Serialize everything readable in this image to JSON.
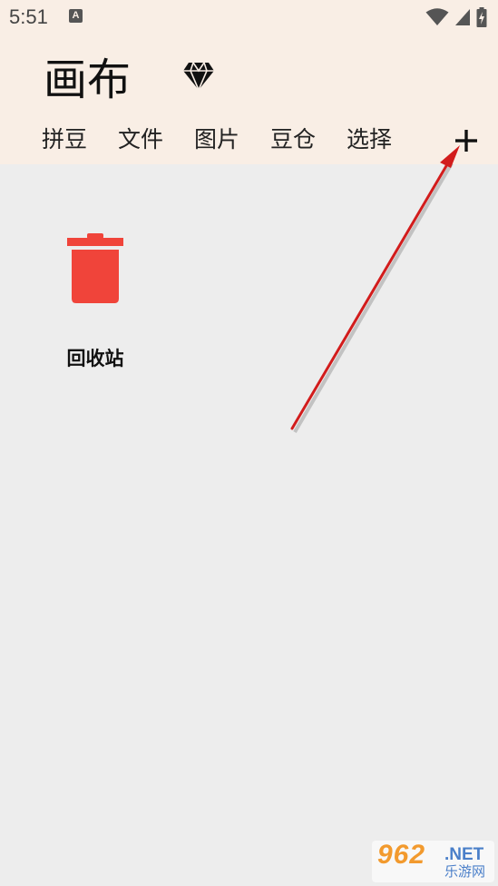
{
  "status_bar": {
    "time": "5:51",
    "notification_icon": "text-a",
    "notification_glyph": "A",
    "icons": [
      "wifi-icon",
      "cellular-signal-icon",
      "battery-charging-icon"
    ]
  },
  "header": {
    "title": "画布",
    "premium_icon": "diamond-icon",
    "background_color": "#f9eee5"
  },
  "tabs": [
    {
      "label": "拼豆"
    },
    {
      "label": "文件"
    },
    {
      "label": "图片"
    },
    {
      "label": "豆仓"
    },
    {
      "label": "选择"
    }
  ],
  "toolbar": {
    "add_icon": "plus-icon",
    "add_label": "+"
  },
  "content": {
    "background_color": "#ededed",
    "items": [
      {
        "label": "回收站",
        "icon": "trash-icon",
        "icon_color": "#f0443a"
      }
    ]
  },
  "annotation": {
    "type": "arrow",
    "color": "#d21c1c"
  },
  "watermark": {
    "logo": "962",
    "suffix": ".NET",
    "subtitle": "乐游网"
  }
}
